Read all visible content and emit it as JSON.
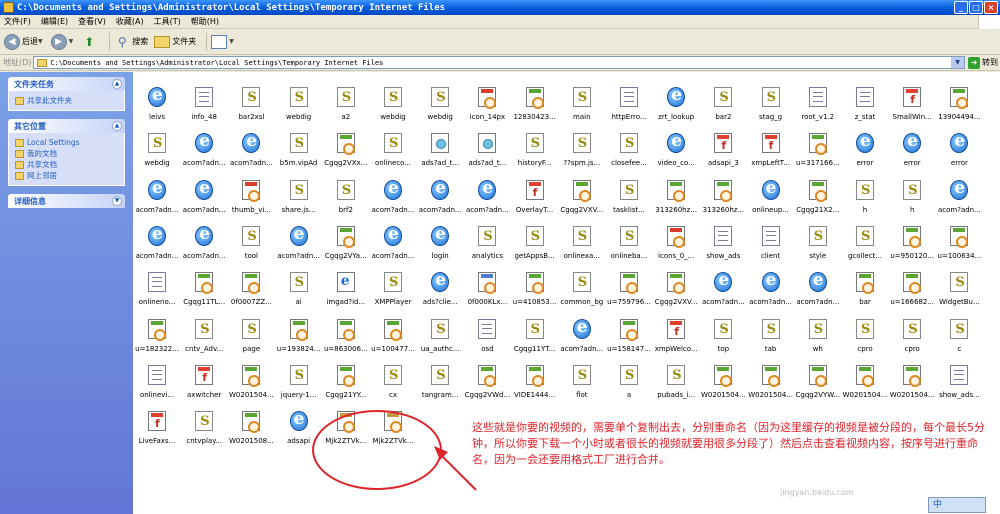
{
  "window": {
    "title": "C:\\Documents and Settings\\Administrator\\Local Settings\\Temporary Internet Files"
  },
  "menu": [
    "文件(F)",
    "编辑(E)",
    "查看(V)",
    "收藏(A)",
    "工具(T)",
    "帮助(H)"
  ],
  "toolbar": {
    "back": "后退",
    "search": "搜索",
    "folders": "文件夹"
  },
  "address": {
    "label": "地址(D)",
    "path": "C:\\Documents and Settings\\Administrator\\Local Settings\\Temporary Internet Files",
    "go": "转到"
  },
  "taskpane": {
    "file_tasks_title": "文件夹任务",
    "file_tasks_items": [
      "共享此文件夹"
    ],
    "other_places_title": "其它位置",
    "other_places_items": [
      "Local Settings",
      "我的文档",
      "共享文档",
      "网上邻居"
    ],
    "details_title": "详细信息"
  },
  "files": [
    [
      [
        "ie",
        "leivs"
      ],
      [
        "doc",
        "info_48"
      ],
      [
        "js",
        "bar2xsl"
      ],
      [
        "js",
        "webdig"
      ],
      [
        "js",
        "a2"
      ],
      [
        "js",
        "webdig"
      ],
      [
        "js",
        "webdig"
      ],
      [
        "img",
        "icon_14px"
      ],
      [
        "img jpg",
        "12830423..."
      ],
      [
        "js",
        "main"
      ],
      [
        "doc",
        "httpErro..."
      ],
      [
        "ie",
        "zrt_lookup"
      ],
      [
        "js",
        "bar2"
      ],
      [
        "js",
        "stag_g"
      ],
      [
        "doc",
        "root_v1.2"
      ],
      [
        "doc",
        "z_stat"
      ],
      [
        "flash",
        "SmallWin..."
      ],
      [
        "img jpg",
        "13904494..."
      ]
    ],
    [
      [
        "js",
        "webdig"
      ],
      [
        "ie",
        "acom?adn..."
      ],
      [
        "ie",
        "acom?adn..."
      ],
      [
        "js",
        "b5m.vipAd"
      ],
      [
        "img jpg",
        "Cgqg2VXx..."
      ],
      [
        "js",
        "onlineco..."
      ],
      [
        "net",
        "ads?ad_t..."
      ],
      [
        "net",
        "ads?ad_t..."
      ],
      [
        "js",
        "historyF..."
      ],
      [
        "js",
        "??spm.js..."
      ],
      [
        "js",
        "closefee..."
      ],
      [
        "ie",
        "video_co..."
      ],
      [
        "flash",
        "adsapi_3"
      ],
      [
        "flash",
        "xmpLeftT..."
      ],
      [
        "img jpg",
        "u=317166..."
      ],
      [
        "ie",
        "error"
      ],
      [
        "ie",
        "error"
      ],
      [
        "ie",
        "error"
      ]
    ],
    [
      [
        "ie",
        "acom?adn..."
      ],
      [
        "ie",
        "acom?adn..."
      ],
      [
        "img",
        "thumb_vi..."
      ],
      [
        "js",
        "share.js..."
      ],
      [
        "js",
        "brf2"
      ],
      [
        "ie",
        "acom?adn..."
      ],
      [
        "ie",
        "acom?adn..."
      ],
      [
        "ie",
        "acom?adn..."
      ],
      [
        "flash",
        "OverlayT..."
      ],
      [
        "img jpg",
        "Cgqg2VXV..."
      ],
      [
        "js",
        "tasklist..."
      ],
      [
        "img jpg",
        "313260hz..."
      ],
      [
        "img jpg",
        "313260hz..."
      ],
      [
        "ie",
        "onlineup..."
      ],
      [
        "img jpg",
        "Cgqg21X2..."
      ],
      [
        "js",
        "h"
      ],
      [
        "js",
        "h"
      ],
      [
        "ie",
        "acom?adn..."
      ]
    ],
    [
      [
        "ie",
        "acom?adn..."
      ],
      [
        "ie",
        "acom?adn..."
      ],
      [
        "js",
        "tool"
      ],
      [
        "ie",
        "acom?adn..."
      ],
      [
        "img jpg",
        "Cgqg2VYa..."
      ],
      [
        "ie",
        "acom?adn..."
      ],
      [
        "ie",
        "login"
      ],
      [
        "js",
        "analytics"
      ],
      [
        "js",
        "getAppsB..."
      ],
      [
        "js",
        "onlinexa..."
      ],
      [
        "js",
        "onlineba..."
      ],
      [
        "img",
        "icons_0_..."
      ],
      [
        "doc",
        "show_ads"
      ],
      [
        "doc",
        "client"
      ],
      [
        "js",
        "style"
      ],
      [
        "js",
        "gcollect..."
      ],
      [
        "img jpg",
        "u=950120..."
      ],
      [
        "img jpg",
        "u=100634..."
      ]
    ],
    [
      [
        "doc",
        "onlineno..."
      ],
      [
        "img jpg",
        "Cgqg11TL..."
      ],
      [
        "img jpg",
        "0f0007ZZ..."
      ],
      [
        "js",
        "ai"
      ],
      [
        "ie-doc",
        "imgad?id..."
      ],
      [
        "js",
        "XMPPlayer"
      ],
      [
        "ie",
        "ads?clie..."
      ],
      [
        "img gif",
        "0f000KLx..."
      ],
      [
        "img jpg",
        "u=410853..."
      ],
      [
        "js",
        "common_bg"
      ],
      [
        "img jpg",
        "u=759796..."
      ],
      [
        "img jpg",
        "Cgqg2VXV..."
      ],
      [
        "ie",
        "acom?adn..."
      ],
      [
        "ie",
        "acom?adn..."
      ],
      [
        "ie",
        "acom?adn..."
      ],
      [
        "img jpg",
        "bar"
      ],
      [
        "img jpg",
        "u=166682..."
      ],
      [
        "js",
        "WidgetBu..."
      ]
    ],
    [
      [
        "img jpg",
        "u=182322..."
      ],
      [
        "js",
        "cntv_Adv..."
      ],
      [
        "js",
        "page"
      ],
      [
        "img jpg",
        "u=193824..."
      ],
      [
        "img jpg",
        "u=863006..."
      ],
      [
        "img jpg",
        "u=100477..."
      ],
      [
        "js",
        "ua_authc..."
      ],
      [
        "doc",
        "osd"
      ],
      [
        "js",
        "Cgqg11YT..."
      ],
      [
        "ie",
        "acom?adn..."
      ],
      [
        "img jpg",
        "u=158147..."
      ],
      [
        "flash",
        "xmpWelco..."
      ],
      [
        "js",
        "top"
      ],
      [
        "js",
        "tab"
      ],
      [
        "js",
        "wh"
      ],
      [
        "js",
        "cpro"
      ],
      [
        "js",
        "cpro"
      ],
      [
        "js",
        "c"
      ]
    ],
    [
      [
        "doc",
        "onlinevi..."
      ],
      [
        "flash",
        "axwitcher"
      ],
      [
        "img jpg",
        "W0201504..."
      ],
      [
        "js",
        "jquery-1..."
      ],
      [
        "img jpg",
        "Cgqg21YY..."
      ],
      [
        "js",
        "cx"
      ],
      [
        "js",
        "tangram..."
      ],
      [
        "img jpg",
        "Cgqg2VWd..."
      ],
      [
        "img jpg",
        "VIDE1444..."
      ],
      [
        "js",
        "flot"
      ],
      [
        "js",
        "a"
      ],
      [
        "js",
        "pubads_i..."
      ],
      [
        "img jpg",
        "W0201504..."
      ],
      [
        "img jpg",
        "W0201504..."
      ],
      [
        "img jpg",
        "Cgqg2VYW..."
      ],
      [
        "img jpg",
        "W0201504..."
      ],
      [
        "img jpg",
        "W0201504..."
      ],
      [
        "doc",
        "show_ads..."
      ]
    ],
    [
      [
        "flash",
        "LiveFaxs..."
      ],
      [
        "js",
        "cntvplay..."
      ],
      [
        "img jpg",
        "W0201508..."
      ],
      [
        "ie",
        "adsapi"
      ],
      [
        "img mp4",
        "Mjk2ZTVk..."
      ],
      [
        "img mp4",
        "Mjk2ZTVk..."
      ]
    ]
  ],
  "annotation": {
    "text": "这些就是你要的视频的，需要单个复制出去，分别重命名（因为这里缓存的视频是被分段的，每个最长5分钟，所以你要下载一个小时或者很长的视频就要用很多分段了）然后点击查看视频内容，按序号进行重命名，因为一会还要用格式工厂进行合并。",
    "color": "#e0232a"
  },
  "watermark": "jingyan.baidu.com",
  "ime": "中"
}
